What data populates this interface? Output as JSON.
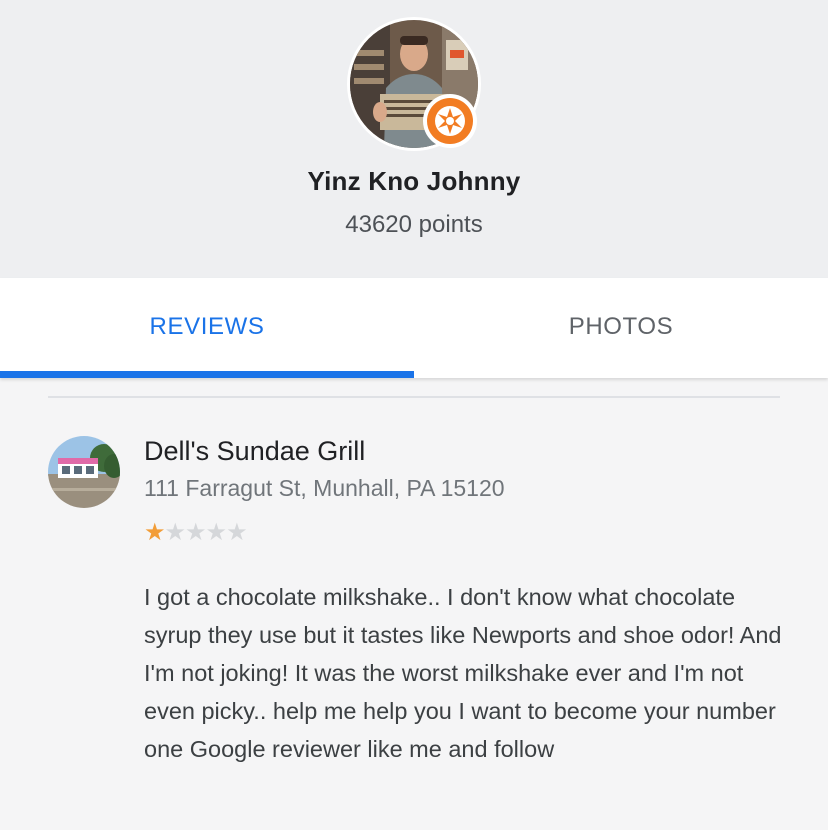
{
  "profile": {
    "name": "Yinz Kno Johnny",
    "points": "43620 points",
    "avatar_icon": "user-photo-avatar",
    "badge_icon": "local-guide-badge-icon",
    "badge_color": "#f27c22"
  },
  "tabs": [
    {
      "label": "REVIEWS",
      "selected": true
    },
    {
      "label": "PHOTOS",
      "selected": false
    }
  ],
  "accent_color": "#1a73e8",
  "review": {
    "place_name": "Dell's Sundae Grill",
    "address": "111 Farragut St, Munhall, PA 15120",
    "rating": 1,
    "rating_max": 5,
    "star_color": "#f29d38",
    "text": "I got a chocolate milkshake.. I don't know what chocolate syrup they use but it tastes like Newports and shoe odor! And I'm not joking! It was the worst milkshake ever and I'm not even picky.. help me help you I want to become your number one Google reviewer like me and follow"
  }
}
